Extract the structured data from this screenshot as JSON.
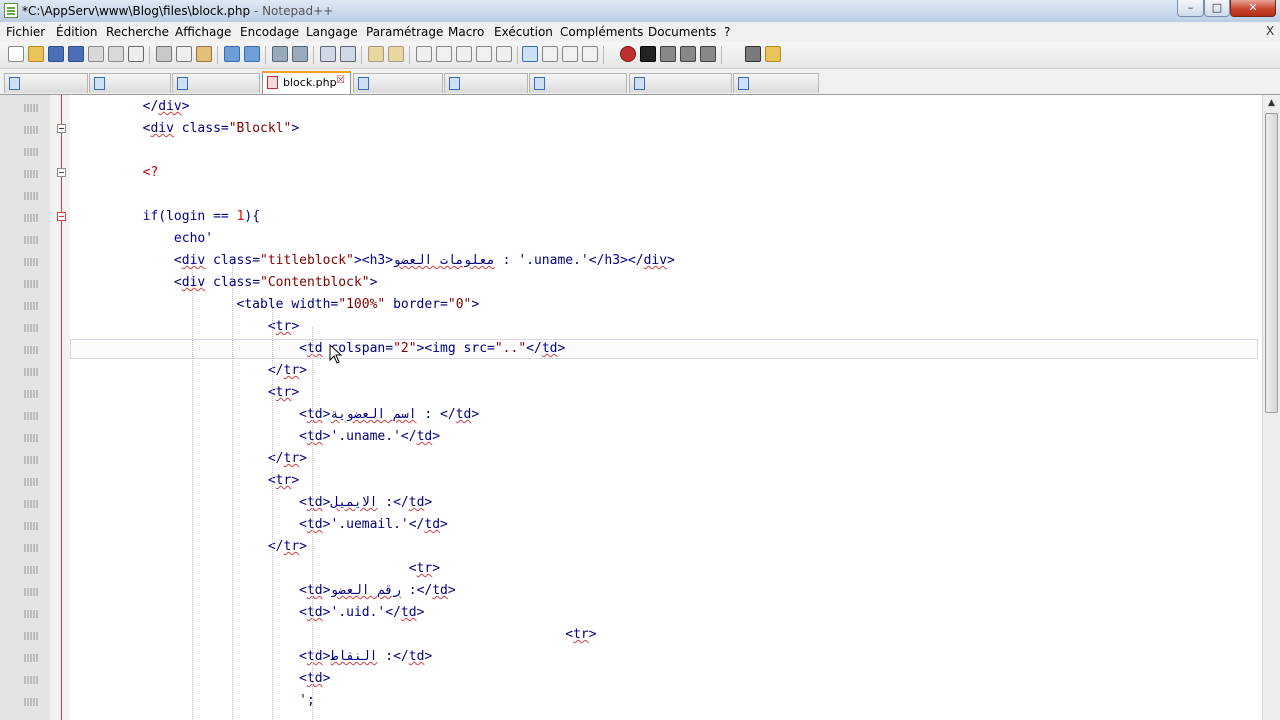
{
  "window": {
    "title_main": "*C:\\AppServ\\www\\Blog\\files\\block.php",
    "title_suffix": " - Notepad++",
    "min_glyph": "–",
    "max_glyph": "□",
    "close_glyph": "✕"
  },
  "menu": {
    "items": [
      "Fichier",
      "Édition",
      "Recherche",
      "Affichage",
      "Encodage",
      "Langage",
      "Paramétrage",
      "Macro",
      "Exécution",
      "Compléments",
      "Documents",
      "?"
    ],
    "close_glyph": "X"
  },
  "tabs": [
    {
      "label": ""
    },
    {
      "label": ""
    },
    {
      "label": ""
    },
    {
      "label": "block.php",
      "active": true
    },
    {
      "label": ""
    },
    {
      "label": ""
    },
    {
      "label": ""
    },
    {
      "label": ""
    },
    {
      "label": ""
    }
  ],
  "tab_close_glyph": "☒",
  "editor": {
    "lines": [
      "        </div>",
      "        <div class=\"Blockl\">",
      "",
      "        <?",
      "",
      "        if(login == 1){",
      "            echo'",
      "            <div class=\"titleblock\"><h3>معلومات العضو : '.uname.'</h3></div>",
      "            <div class=\"Contentblock\">",
      "                    <table width=\"100%\" border=\"0\">",
      "                        <tr>",
      "                            <td colspan=\"2\"><img src=\"..\"</td>",
      "                        </tr>",
      "                        <tr>",
      "                            <td>اسم العضوية : </td>",
      "                            <td>'.uname.'</td>",
      "                        </tr>",
      "                        <tr>",
      "                            <td>الايميل :</td>",
      "                            <td>'.uemail.'</td>",
      "                        </tr>",
      "                                          <tr>",
      "                            <td>رقم العضو :</td>",
      "                            <td>'.uid.'</td>",
      "                                                              <tr>",
      "                            <td>النقاط :</td>",
      "                            <td>",
      "                            ';"
    ]
  },
  "colors": {
    "active_tab_accent": "#f0a030",
    "fold_line": "#d04040",
    "string": "#800000",
    "php_tag": "#c00000"
  }
}
